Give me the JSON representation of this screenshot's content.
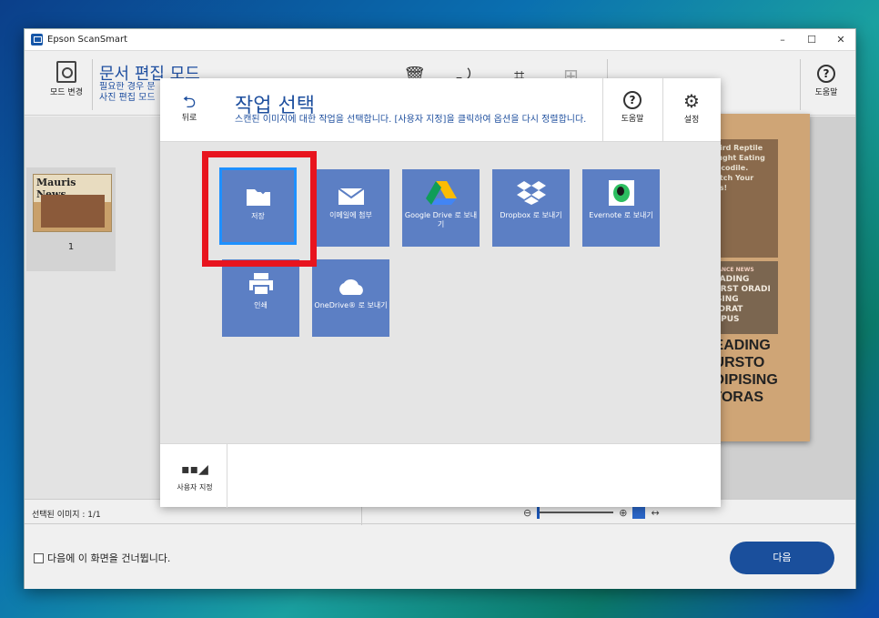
{
  "window": {
    "title": "Epson ScanSmart",
    "controls": {
      "minimize": "–",
      "maximize": "☐",
      "close": "✕"
    }
  },
  "toolbar": {
    "mode_change_label": "모드 변경",
    "mode_title": "문서 편집 모드",
    "mode_desc_line1": "필요한 경우 문",
    "mode_desc_line2": "사진 편집 모드",
    "help_label": "도움말"
  },
  "thumbnails": [
    {
      "headline": "Mauris News",
      "page": "1"
    }
  ],
  "preview": {
    "col_text": "Weird Reptile Caught Eating Crocodile. Watch Your kids!",
    "col2_text": "HEADING DURST ORADI PISING ATORAT EMPUS",
    "big_text": "HEADING DURSTO ADIPISING ATORAS",
    "section_tag": "FINANCE NEWS"
  },
  "status": {
    "selected": "선택된 이미지 : 1/1"
  },
  "bottom": {
    "skip_label": "다음에 이 화면을 건너뜁니다.",
    "next_label": "다음"
  },
  "dialog": {
    "back_label": "뒤로",
    "title": "작업 선택",
    "description": "스캔된 이미지에 대한 작업을 선택합니다. [사용자 지정]을 클릭하여 옵션을 다시 정렬합니다.",
    "help_label": "도움말",
    "settings_label": "설정",
    "custom_label": "사용자 지정",
    "tiles": [
      {
        "label": "저장",
        "icon": "folder-save-icon",
        "selected": true
      },
      {
        "label": "이메일에 첨부",
        "icon": "envelope-icon",
        "selected": false
      },
      {
        "label": "Google Drive 로 보내기",
        "icon": "google-drive-icon",
        "selected": false
      },
      {
        "label": "Dropbox 로 보내기",
        "icon": "dropbox-icon",
        "selected": false
      },
      {
        "label": "Evernote 로 보내기",
        "icon": "evernote-icon",
        "selected": false
      },
      {
        "label": "인쇄",
        "icon": "printer-icon",
        "selected": false
      },
      {
        "label": "OneDrive® 로 보내기",
        "icon": "onedrive-icon",
        "selected": false
      }
    ]
  },
  "colors": {
    "tile": "#5c7fc4",
    "accent": "#1e4f9e",
    "highlight": "#e8141e",
    "selection": "#1e90ff"
  }
}
